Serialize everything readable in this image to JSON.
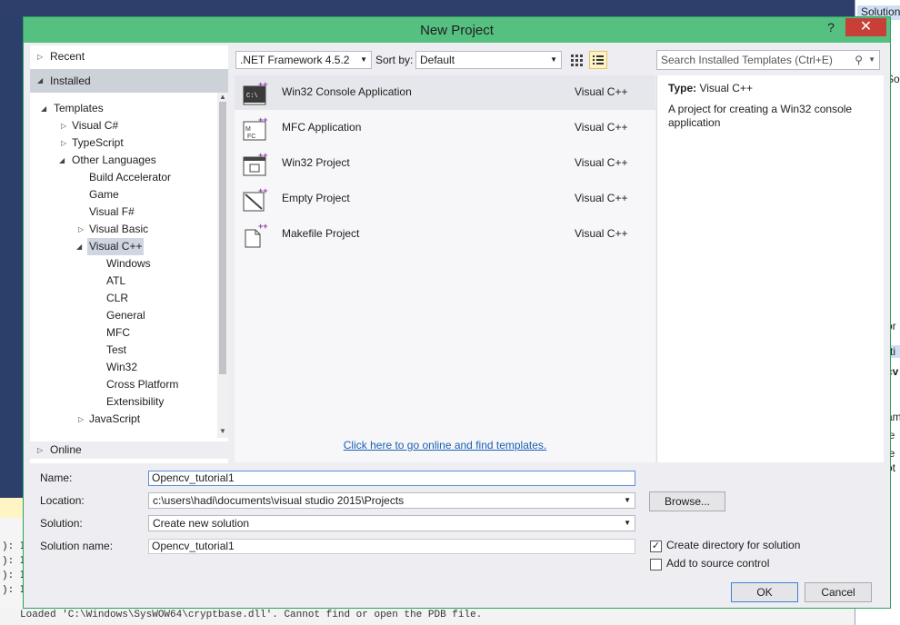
{
  "window": {
    "title": "New Project",
    "help_glyph": "?",
    "close_glyph": "✕"
  },
  "background": {
    "right_tab": "Solution",
    "right_fragments": [
      "So",
      "or",
      "rti",
      "cv",
      "am",
      "je",
      "je",
      "ot"
    ],
    "bottom_lines": [
      "): I",
      "): I",
      "): I",
      "): I"
    ],
    "output_line": "Loaded 'C:\\Windows\\SysWOW64\\cryptbase.dll'. Cannot find or open the PDB file."
  },
  "left_tree": {
    "recent": "Recent",
    "installed": "Installed",
    "templates": "Templates",
    "items": [
      {
        "label": "Visual C#"
      },
      {
        "label": "TypeScript"
      },
      {
        "label": "Other Languages"
      },
      {
        "label": "Build Accelerator"
      },
      {
        "label": "Game"
      },
      {
        "label": "Visual F#"
      },
      {
        "label": "Visual Basic"
      },
      {
        "label": "Visual C++"
      },
      {
        "label": "Windows"
      },
      {
        "label": "ATL"
      },
      {
        "label": "CLR"
      },
      {
        "label": "General"
      },
      {
        "label": "MFC"
      },
      {
        "label": "Test"
      },
      {
        "label": "Win32"
      },
      {
        "label": "Cross Platform"
      },
      {
        "label": "Extensibility"
      },
      {
        "label": "JavaScript"
      }
    ],
    "online": "Online"
  },
  "toolbar": {
    "framework": ".NET Framework 4.5.2",
    "sort_label": "Sort by:",
    "sort_value": "Default",
    "search_placeholder": "Search Installed Templates (Ctrl+E)"
  },
  "templates": [
    {
      "name": "Win32 Console Application",
      "language": "Visual C++"
    },
    {
      "name": "MFC Application",
      "language": "Visual C++"
    },
    {
      "name": "Win32 Project",
      "language": "Visual C++"
    },
    {
      "name": "Empty Project",
      "language": "Visual C++"
    },
    {
      "name": "Makefile Project",
      "language": "Visual C++"
    }
  ],
  "online_link": "Click here to go online and find templates.",
  "description": {
    "type_label": "Type:",
    "type_value": "Visual C++",
    "text": "A project for creating a Win32 console application"
  },
  "form": {
    "name_label": "Name:",
    "name_value": "Opencv_tutorial1",
    "location_label": "Location:",
    "location_value": "c:\\users\\hadi\\documents\\visual studio 2015\\Projects",
    "browse_label": "Browse...",
    "solution_label": "Solution:",
    "solution_value": "Create new solution",
    "solution_name_label": "Solution name:",
    "solution_name_value": "Opencv_tutorial1",
    "create_dir_label": "Create directory for solution",
    "source_control_label": "Add to source control",
    "ok_label": "OK",
    "cancel_label": "Cancel"
  },
  "colors": {
    "titlebar": "#55c080",
    "close": "#c73f36",
    "link": "#1a5fb4",
    "accent_icon": "#8a3fa0"
  }
}
